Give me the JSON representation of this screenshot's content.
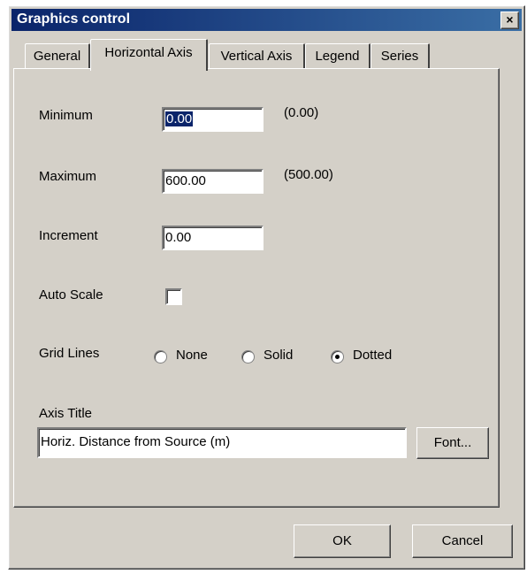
{
  "window": {
    "title": "Graphics control",
    "close_glyph": "×"
  },
  "tabs": [
    {
      "label": "General"
    },
    {
      "label": "Horizontal Axis",
      "active": true
    },
    {
      "label": "Vertical Axis"
    },
    {
      "label": "Legend"
    },
    {
      "label": "Series"
    }
  ],
  "minimum": {
    "label": "Minimum",
    "value": "0.00",
    "hint": "(0.00)"
  },
  "maximum": {
    "label": "Maximum",
    "value": "600.00",
    "hint": "(500.00)"
  },
  "increment": {
    "label": "Increment",
    "value": "0.00"
  },
  "auto_scale": {
    "label": "Auto Scale",
    "checked": false
  },
  "grid_lines": {
    "label": "Grid Lines",
    "options": [
      {
        "label": "None",
        "selected": false
      },
      {
        "label": "Solid",
        "selected": false
      },
      {
        "label": "Dotted",
        "selected": true
      }
    ]
  },
  "axis_title": {
    "label": "Axis Title",
    "value": "Horiz. Distance from Source (m)",
    "font_button": "Font..."
  },
  "buttons": {
    "ok": "OK",
    "cancel": "Cancel"
  }
}
